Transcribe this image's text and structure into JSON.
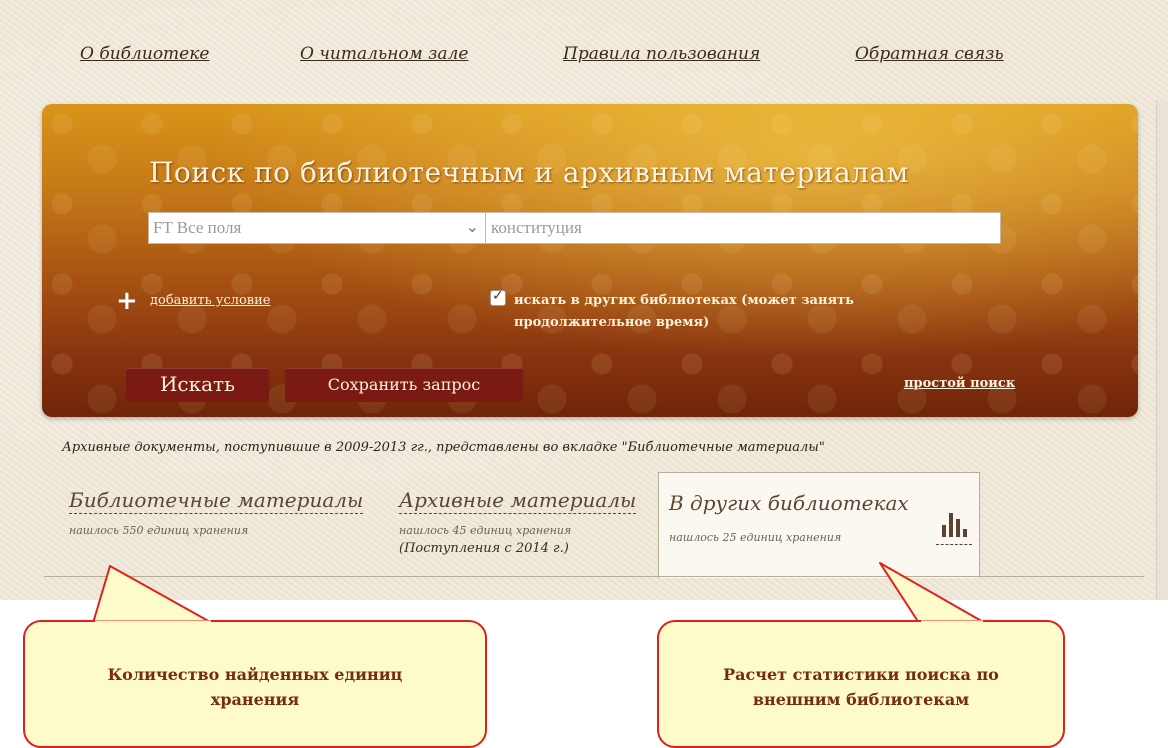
{
  "nav": {
    "about_library": "О библиотеке",
    "about_reading_room": "О читальном зале",
    "usage_rules": "Правила пользования",
    "feedback": "Обратная связь"
  },
  "search": {
    "title": "Поиск по библиотечным и архивным материалам",
    "field_select_value": "FT Все поля",
    "query_value": "конституция",
    "add_condition": "добавить условие",
    "other_libraries_checked": true,
    "other_libraries_label": "искать в других библиотеках (может занять продолжительное время)",
    "search_button": "Искать",
    "save_query_button": "Сохранить запрос",
    "simple_search_link": "простой поиск"
  },
  "notice": "Архивные документы, поступившие в 2009-2013 гг., представлены во вкладке \"Библиотечные материалы\"",
  "tabs": [
    {
      "title": "Библиотечные материалы",
      "count": "нашлось 550 единиц хранения"
    },
    {
      "title": "Архивные материалы",
      "count": "нашлось 45 единиц хранения",
      "extra": "(Поступления с 2014 г.)"
    },
    {
      "title": "В других библиотеках",
      "count": "нашлось 25 единиц хранения",
      "active": true
    }
  ],
  "icons": {
    "chevron": "chevron-down-icon",
    "plus": "plus-icon",
    "check": "check-icon",
    "stats": "bar-chart-icon"
  },
  "callouts": {
    "left": "Количество найденных единиц хранения",
    "right": "Расчет статистики поиска по внешним библиотекам"
  },
  "colors": {
    "panel_top": "#d9951a",
    "panel_bottom": "#6f2508",
    "button": "#7a1a12",
    "callout_border": "#e02020",
    "callout_fill": "#fdfbc9",
    "callout_text": "#7a2a10"
  }
}
